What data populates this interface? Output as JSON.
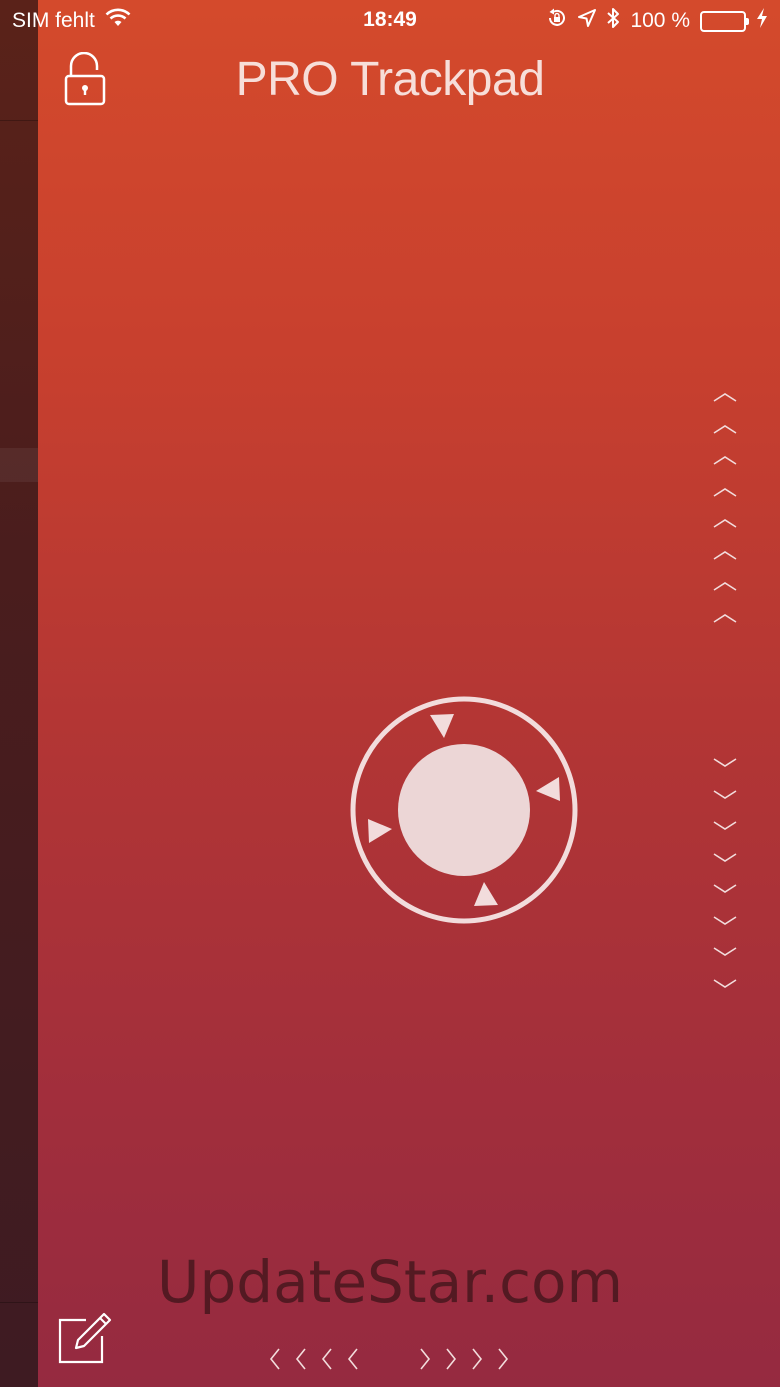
{
  "status_bar": {
    "carrier": "SIM fehlt",
    "time": "18:49",
    "battery_text": "100 %",
    "battery_level": 1.0,
    "icons": [
      "wifi-icon",
      "rotation-lock-icon",
      "location-icon",
      "bluetooth-icon",
      "battery-icon",
      "charging-icon"
    ]
  },
  "header": {
    "title": "PRO Trackpad",
    "lock_icon": "unlocked-padlock-icon"
  },
  "scroll_controls": {
    "up_icon": "chevron-up-icon",
    "down_icon": "chevron-down-icon",
    "left_icon": "chevron-left-icon",
    "right_icon": "chevron-right-icon"
  },
  "joystick": {
    "icon": "joystick-icon"
  },
  "watermark": "UpdateStar.com",
  "footer": {
    "edit_icon": "edit-icon"
  },
  "colors": {
    "gradient_top": "#d44a2c",
    "gradient_bottom": "#952a40",
    "control": "#f2dcdc",
    "battery": "#7bdc5f"
  }
}
